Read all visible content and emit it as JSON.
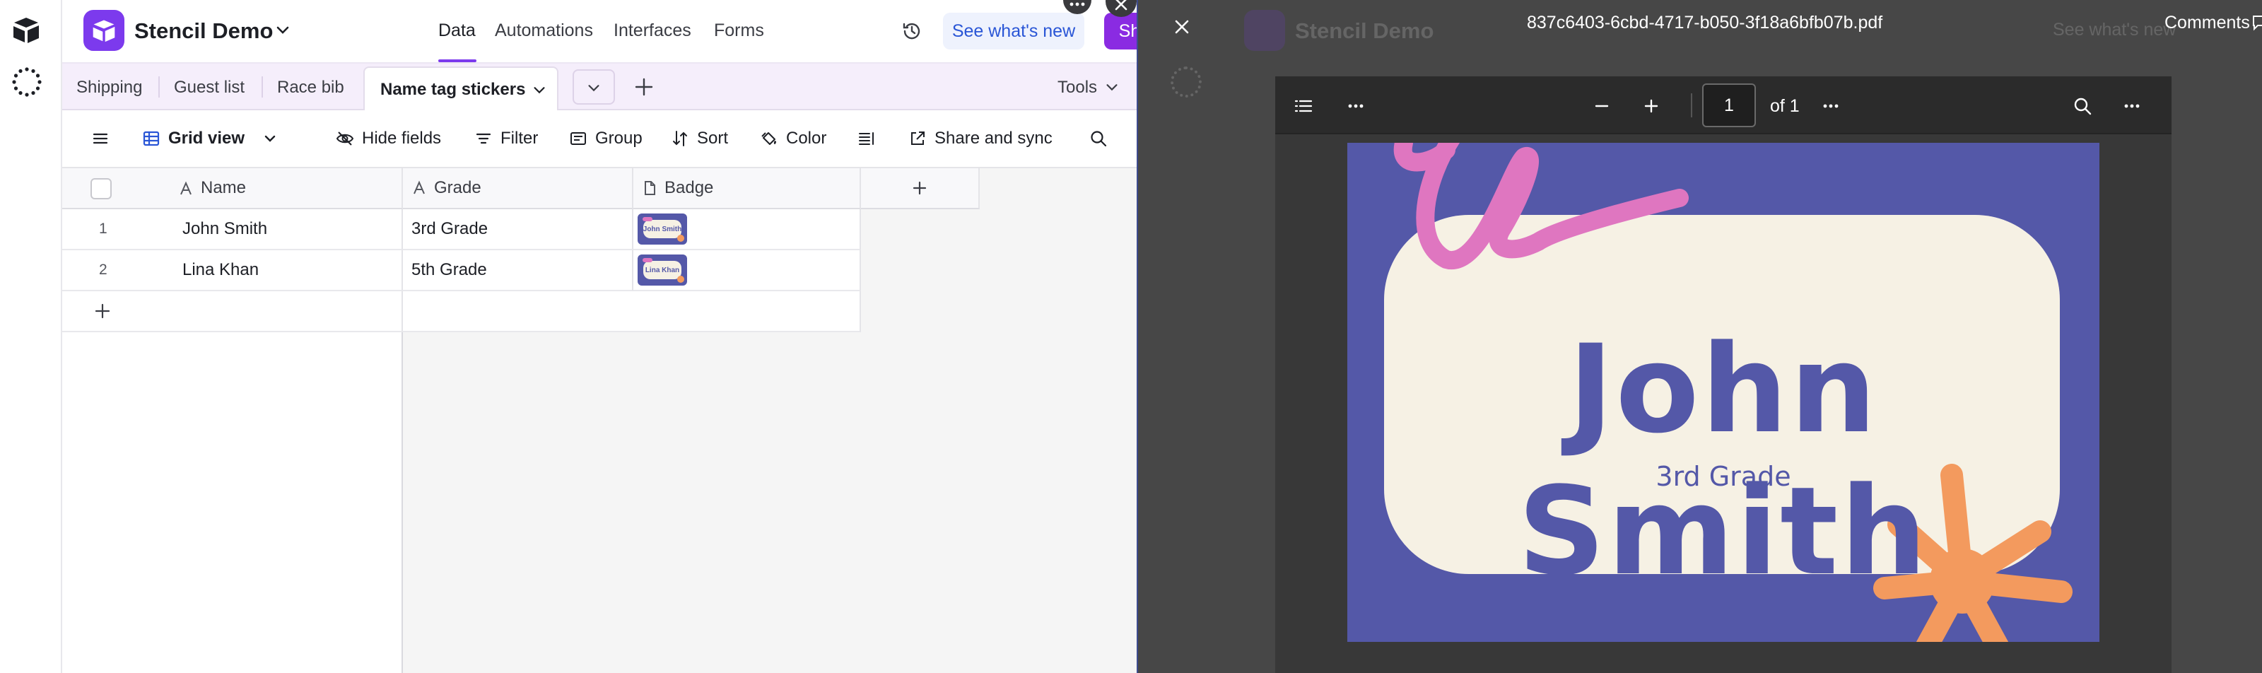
{
  "rail": {
    "logo_icon": "airtable-logo-icon",
    "spinner_icon": "loading-spinner-icon"
  },
  "base": {
    "name": "Stencil Demo",
    "nav_tabs": [
      {
        "label": "Data",
        "active": true
      },
      {
        "label": "Automations",
        "active": false
      },
      {
        "label": "Interfaces",
        "active": false
      },
      {
        "label": "Forms",
        "active": false
      }
    ],
    "whats_new": "See what's new",
    "share": "Share"
  },
  "tables": {
    "tabs": [
      "Shipping",
      "Guest list",
      "Race bib"
    ],
    "active": "Name tag stickers",
    "tools": "Tools"
  },
  "viewbar": {
    "view_name": "Grid view",
    "hide_fields": "Hide fields",
    "filter": "Filter",
    "group": "Group",
    "sort": "Sort",
    "color": "Color",
    "share_sync": "Share and sync"
  },
  "grid": {
    "columns": [
      "Name",
      "Grade",
      "Badge"
    ],
    "rows": [
      {
        "num": "1",
        "name": "John Smith",
        "grade": "3rd Grade",
        "badge_thumb": "John Smith"
      },
      {
        "num": "2",
        "name": "Lina Khan",
        "grade": "5th Grade",
        "badge_thumb": "Lina Khan"
      }
    ]
  },
  "overlay": {
    "filename": "837c6403-6cbd-4717-b050-3f18a6bfb07b.pdf",
    "comments": "Comments",
    "page_current": "1",
    "page_of": "of 1"
  },
  "badge": {
    "name": "John Smith",
    "grade": "3rd Grade"
  },
  "colors": {
    "accent": "#8a2be2",
    "badge_bg": "#5458a8",
    "badge_card": "#f6f1e4",
    "badge_pink": "#df76c0",
    "badge_orange": "#f39a5e"
  }
}
